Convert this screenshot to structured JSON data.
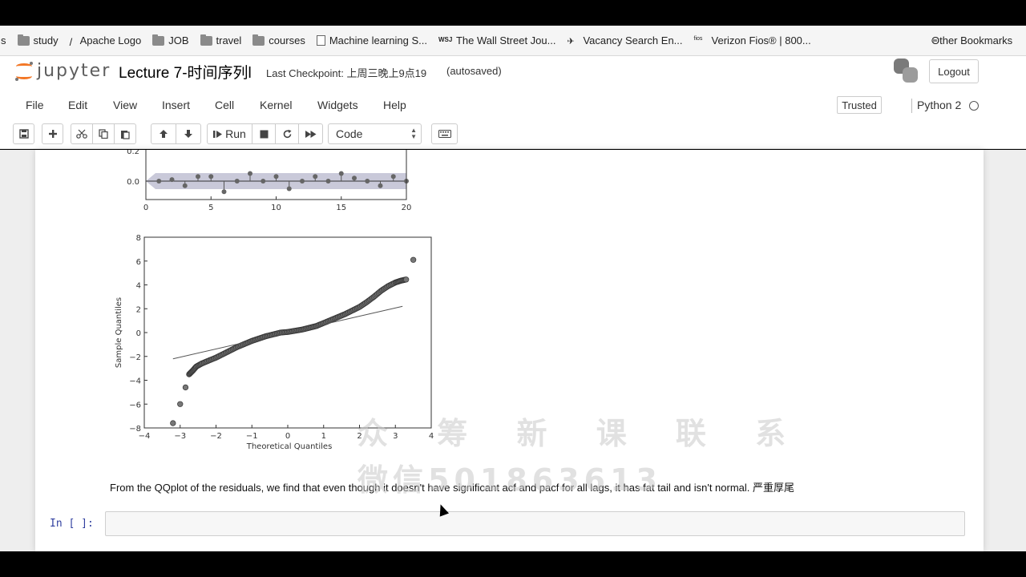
{
  "bookmarks": {
    "items": [
      {
        "label": "s",
        "icon": "none"
      },
      {
        "label": "study",
        "icon": "folder-icon"
      },
      {
        "label": "Apache Logo",
        "icon": "feather-icon"
      },
      {
        "label": "JOB",
        "icon": "folder-icon"
      },
      {
        "label": "travel",
        "icon": "folder-icon"
      },
      {
        "label": "courses",
        "icon": "folder-icon"
      },
      {
        "label": "Machine learning S...",
        "icon": "page-icon"
      },
      {
        "label": "The Wall Street Jou...",
        "icon": "wsj-icon"
      },
      {
        "label": "Vacancy Search En...",
        "icon": "search-person-icon"
      },
      {
        "label": "Verizon Fios® | 800...",
        "icon": "fios-icon"
      }
    ],
    "other": "Other Bookmarks"
  },
  "header": {
    "logo_text": "jupyter",
    "notebook_title": "Lecture 7-时间序列l",
    "checkpoint": "Last Checkpoint: 上周三晚上9点19",
    "autosaved": "(autosaved)",
    "logout": "Logout"
  },
  "menu": {
    "items": [
      "File",
      "Edit",
      "View",
      "Insert",
      "Cell",
      "Kernel",
      "Widgets",
      "Help"
    ],
    "trusted": "Trusted",
    "kernel": "Python 2"
  },
  "toolbar": {
    "run_label": "Run",
    "cell_type": "Code"
  },
  "chart_data": [
    {
      "type": "scatter",
      "description_visible": "stem plot (partial, top cut off)",
      "x": [
        0,
        1,
        2,
        3,
        4,
        5,
        6,
        7,
        8,
        9,
        10,
        11,
        12,
        13,
        14,
        15,
        16,
        17,
        18,
        19,
        20
      ],
      "y": [
        0.0,
        0.0,
        0.01,
        -0.03,
        0.03,
        0.03,
        -0.07,
        0.0,
        0.05,
        0.0,
        0.03,
        -0.05,
        0.0,
        0.03,
        0.0,
        0.05,
        0.02,
        0.0,
        -0.03,
        0.03,
        0.0
      ],
      "xticks": [
        "0",
        "5",
        "10",
        "15",
        "20"
      ],
      "yticks": [
        "0.2",
        "0.0"
      ],
      "xlim": [
        0,
        20
      ]
    },
    {
      "type": "scatter",
      "xlabel": "Theoretical Quantiles",
      "ylabel": "Sample Quantiles",
      "xlim": [
        -4,
        4
      ],
      "ylim": [
        -8,
        8
      ],
      "xticks": [
        "−4",
        "−3",
        "−2",
        "−1",
        "0",
        "1",
        "2",
        "3",
        "4"
      ],
      "yticks": [
        "8",
        "6",
        "4",
        "2",
        "0",
        "−2",
        "−4",
        "−6",
        "−8"
      ],
      "reference_line": {
        "x": [
          -3.2,
          3.2
        ],
        "y": [
          -2.2,
          2.2
        ]
      },
      "points": [
        [
          -3.2,
          -7.6
        ],
        [
          -3.0,
          -6.0
        ],
        [
          -2.85,
          -4.6
        ],
        [
          -2.75,
          -3.5
        ],
        [
          -2.65,
          -3.2
        ],
        [
          -2.55,
          -2.85
        ],
        [
          -2.4,
          -2.6
        ],
        [
          -2.2,
          -2.35
        ],
        [
          -2.0,
          -2.1
        ],
        [
          -1.8,
          -1.8
        ],
        [
          -1.6,
          -1.5
        ],
        [
          -1.4,
          -1.2
        ],
        [
          -1.2,
          -0.95
        ],
        [
          -1.0,
          -0.7
        ],
        [
          -0.8,
          -0.5
        ],
        [
          -0.6,
          -0.3
        ],
        [
          -0.4,
          -0.15
        ],
        [
          -0.2,
          0.0
        ],
        [
          0.0,
          0.05
        ],
        [
          0.2,
          0.15
        ],
        [
          0.4,
          0.25
        ],
        [
          0.6,
          0.4
        ],
        [
          0.8,
          0.55
        ],
        [
          1.0,
          0.8
        ],
        [
          1.2,
          1.05
        ],
        [
          1.4,
          1.3
        ],
        [
          1.6,
          1.55
        ],
        [
          1.8,
          1.85
        ],
        [
          2.0,
          2.15
        ],
        [
          2.2,
          2.55
        ],
        [
          2.4,
          3.0
        ],
        [
          2.6,
          3.5
        ],
        [
          2.8,
          3.9
        ],
        [
          3.0,
          4.2
        ],
        [
          3.15,
          4.35
        ],
        [
          3.3,
          4.45
        ],
        [
          3.5,
          6.1
        ]
      ]
    }
  ],
  "markdown_text": "From the QQplot of the residuals, we find that even though it doesn't have significant acf and pacf for all lags, it has fat tail and isn't normal. 严重厚尾",
  "input_prompt": "In [ ]:",
  "watermark": {
    "line1": "众 筹 新 课 联 系",
    "line2": "微信501863613"
  }
}
